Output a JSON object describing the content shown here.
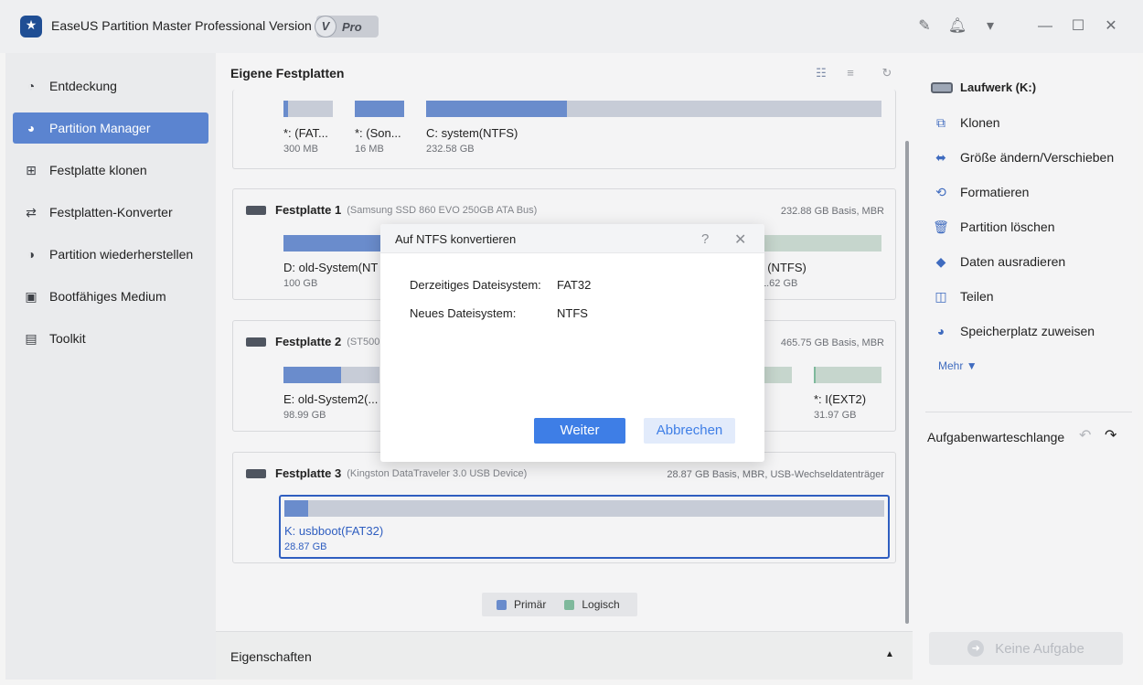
{
  "app": {
    "title": "EaseUS Partition Master Professional Version",
    "badge_v": "V",
    "badge_pro": "Pro"
  },
  "sidebar": {
    "items": [
      {
        "label": "Entdeckung",
        "icon": "compass-icon"
      },
      {
        "label": "Partition Manager",
        "icon": "pie-chart-icon",
        "active": true
      },
      {
        "label": "Festplatte klonen",
        "icon": "clone-disk-icon"
      },
      {
        "label": "Festplatten-Konverter",
        "icon": "convert-disk-icon"
      },
      {
        "label": "Partition wiederherstellen",
        "icon": "recover-partition-icon"
      },
      {
        "label": "Bootfähiges Medium",
        "icon": "bootable-media-icon"
      },
      {
        "label": "Toolkit",
        "icon": "toolbox-icon"
      }
    ]
  },
  "main": {
    "title": "Eigene Festplatten",
    "disk0": {
      "partitions": [
        {
          "name": "*: (FAT...",
          "size": "300 MB",
          "fill_pct": 10,
          "type": "primary"
        },
        {
          "name": "*: (Son...",
          "size": "16 MB",
          "fill_pct": 100,
          "type": "primary"
        },
        {
          "name": "C: system(NTFS)",
          "size": "232.58 GB",
          "fill_pct": 31,
          "type": "primary"
        }
      ]
    },
    "disk1": {
      "name": "Festplatte 1",
      "model": "(Samsung SSD 860 EVO 250GB ATA Bus)",
      "info": "232.88 GB Basis, MBR",
      "partitions": [
        {
          "name": "D: old-System(NT",
          "size": "100 GB",
          "fill_pct": 100,
          "type": "primary"
        },
        {
          "name": ": (NTFS)",
          "size": "1.62 GB",
          "fill_pct": 0,
          "type": "logical"
        }
      ]
    },
    "disk2": {
      "name": "Festplatte 2",
      "model": "(ST500",
      "info": "465.75 GB Basis, MBR",
      "partitions": [
        {
          "name": "E: old-System2(...",
          "size": "98.99 GB",
          "fill_pct": 60,
          "type": "primary"
        },
        {
          "name": "",
          "size": "",
          "fill_pct": 0,
          "type": "logical"
        },
        {
          "name": "*: I(EXT2)",
          "size": "31.97 GB",
          "fill_pct": 3,
          "type": "logical"
        }
      ]
    },
    "disk3": {
      "name": "Festplatte 3",
      "model": "(Kingston DataTraveler 3.0 USB Device)",
      "info": "28.87 GB Basis, MBR, USB-Wechseldatenträger",
      "partitions": [
        {
          "name": "K: usbboot(FAT32)",
          "size": "28.87 GB",
          "fill_pct": 4,
          "type": "primary",
          "selected": true
        }
      ]
    },
    "legend": {
      "primary": "Primär",
      "logical": "Logisch",
      "primary_color": "#6a8ccc",
      "logical_color": "#7fb99c"
    },
    "properties_label": "Eigenschaften"
  },
  "right": {
    "drive_label": "Laufwerk (K:)",
    "actions": [
      {
        "label": "Klonen",
        "icon": "clone-icon"
      },
      {
        "label": "Größe ändern/Verschieben",
        "icon": "resize-icon"
      },
      {
        "label": "Formatieren",
        "icon": "format-icon"
      },
      {
        "label": "Partition löschen",
        "icon": "trash-icon"
      },
      {
        "label": "Daten ausradieren",
        "icon": "eraser-icon"
      },
      {
        "label": "Teilen",
        "icon": "split-icon"
      },
      {
        "label": "Speicherplatz zuweisen",
        "icon": "allocate-space-icon"
      }
    ],
    "more_label": "Mehr",
    "queue_label": "Aufgabenwarteschlange",
    "no_task_label": "Keine Aufgabe"
  },
  "modal": {
    "title": "Auf NTFS konvertieren",
    "current_fs_label": "Derzeitiges Dateisystem:",
    "current_fs_value": "FAT32",
    "new_fs_label": "Neues Dateisystem:",
    "new_fs_value": "NTFS",
    "ok_label": "Weiter",
    "cancel_label": "Abbrechen"
  },
  "colors": {
    "accent": "#3e7ee6",
    "sidebar_active": "#5b84d0",
    "primary_partition": "#6a8ccc",
    "logical_partition": "#7fb99c"
  }
}
